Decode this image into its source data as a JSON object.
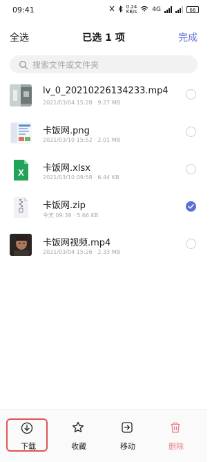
{
  "status_bar": {
    "time": "09:41",
    "speed_value": "0.24",
    "speed_unit": "KB/s",
    "network": "4G",
    "battery": "66"
  },
  "topbar": {
    "left_label": "全选",
    "title": "已选 1 项",
    "done_label": "完成"
  },
  "search": {
    "placeholder": "搜索文件或文件夹"
  },
  "files": [
    {
      "name": "lv_0_20210226134233.mp4",
      "meta": "2021/03/04 15:28 · 9.27 MB",
      "thumb": "video-thumb",
      "checked": false
    },
    {
      "name": "卡饭网.png",
      "meta": "2021/03/10 15:52 · 2.01 MB",
      "thumb": "image-thumb",
      "checked": false
    },
    {
      "name": "卡饭网.xlsx",
      "meta": "2021/03/10 09:58 · 6.44 KB",
      "thumb": "excel-icon",
      "checked": false
    },
    {
      "name": "卡饭网.zip",
      "meta": "今天 09:38 · 5.66 KB",
      "thumb": "zip-icon",
      "checked": true
    },
    {
      "name": "卡饭网视频.mp4",
      "meta": "2021/03/04 15:26 · 2.33 MB",
      "thumb": "video-thumb",
      "checked": false
    }
  ],
  "bottom_actions": [
    {
      "label": "下载",
      "icon": "download-icon"
    },
    {
      "label": "收藏",
      "icon": "star-icon"
    },
    {
      "label": "移动",
      "icon": "move-icon"
    },
    {
      "label": "删除",
      "icon": "trash-icon"
    }
  ],
  "colors": {
    "accent": "#5b6fd8",
    "delete": "#e8818d",
    "highlight": "#e05555"
  }
}
